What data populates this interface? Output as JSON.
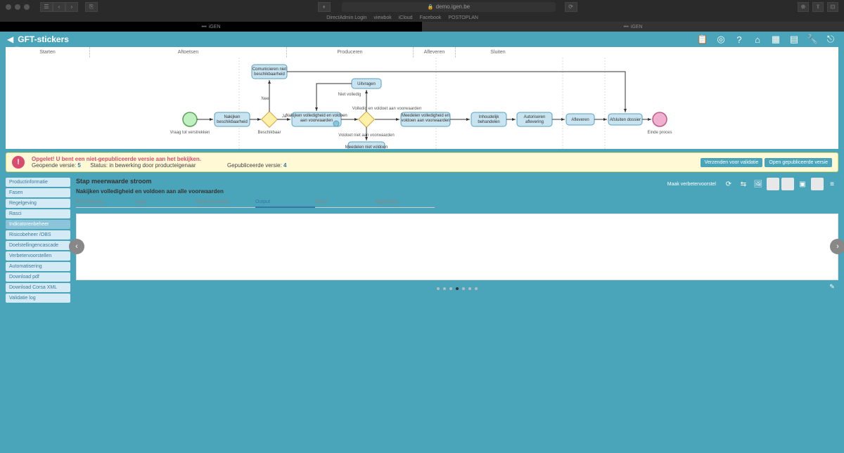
{
  "browser": {
    "url": "demo.igen.be",
    "bookmarks": [
      "DirectAdmin Login",
      "viewbok",
      "iCloud",
      "Facebook",
      "POSTOPLAN"
    ],
    "tabs": [
      {
        "label": "iGEN",
        "active": true
      },
      {
        "label": "iGEN",
        "active": false
      }
    ]
  },
  "header": {
    "title": "GFT-stickers"
  },
  "diagram": {
    "phases": [
      "Starten",
      "Aftoetsen",
      "Produceren",
      "Afleveren",
      "Sluiten"
    ],
    "start_label": "Vraag tot verstrekken",
    "gateway1_label": "Beschikbaar",
    "end_label": "Einde proces",
    "nee": "Nee",
    "ja": "Ja",
    "niet_volledig": "Niet volledig",
    "volledig": "Volledig en voldoet aan voorwaarden",
    "voldoet_niet": "Voldoet niet aan voorwaarden",
    "tasks": {
      "t1": "Nakijken beschikbaarheid",
      "t2": "Comunicieren niet beschikbaarheid",
      "t3": "Uitvragen",
      "t4": "Nakijken volledigheid en voldoen aan voorwaarden",
      "t5": "Meedelen volledigheid en voldoen aan voorwaarden",
      "t6": "Inhoudelijk behandelen",
      "t7": "Autoriseren aflevering",
      "t8": "Afleveren",
      "t9": "Afsluiten dossier",
      "t10": "Meedelen niet voldoen"
    }
  },
  "warning": {
    "title": "Opgelet! U bent een niet-gepubliceerde versie aan het bekijken.",
    "open_label": "Geopende versie:",
    "open_version": "5",
    "status_label": "Status:",
    "status_value": "in bewerking door producteigenaar",
    "pub_label": "Gepubliceerde versie:",
    "pub_version": "4",
    "btn1": "Verzenden voor validatie",
    "btn2": "Open gepubliceerde versie"
  },
  "sidebar": {
    "items": [
      "Productinformatie",
      "Fasen",
      "Regelgeving",
      "Rasci",
      "Indicatorenbeheer",
      "Risicobeheer /OBS",
      "Doelstellingencascade",
      "Verbetervoorstellen",
      "Automatisering",
      "Download pdf",
      "Download Corsa XML",
      "Validatie log"
    ]
  },
  "content": {
    "title": "Stap meerwaarde stroom",
    "subtitle": "Nakijken volledigheid en voldoen aan alle voorwaarden",
    "action_label": "Maak verbetervoorstel",
    "tabs": [
      "Beschrijving",
      "Input",
      "Werkinstructies",
      "Output",
      "Rasci",
      "Applicaties"
    ],
    "active_tab": 3
  }
}
